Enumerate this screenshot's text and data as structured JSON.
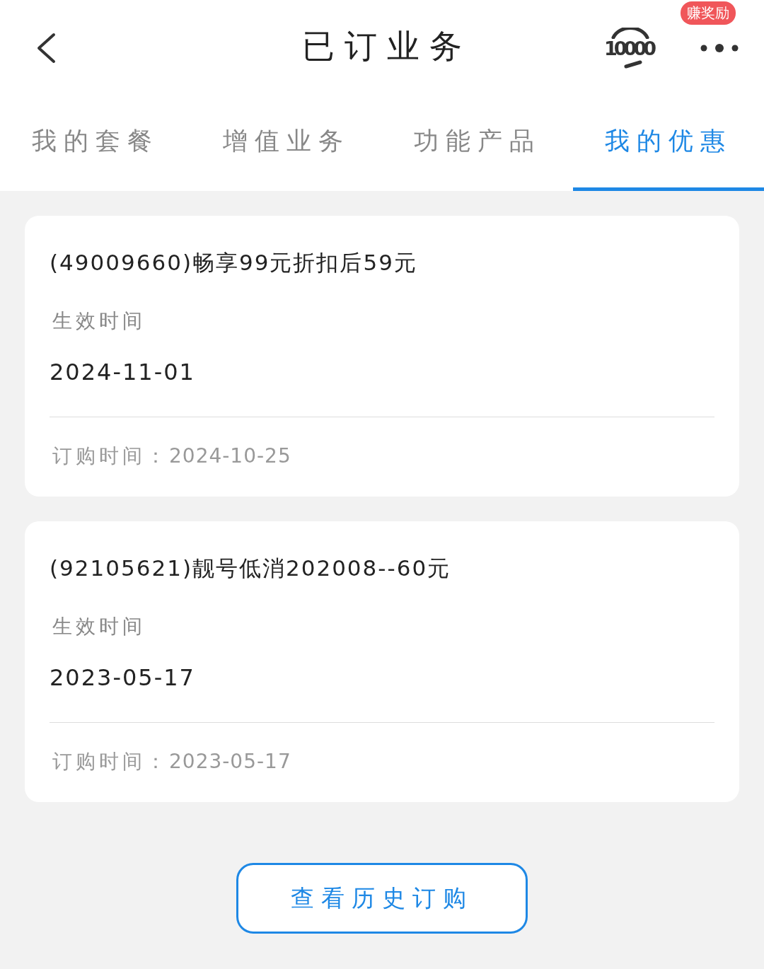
{
  "header": {
    "title": "已订业务",
    "hotline_label": "10000",
    "reward_badge": "赚奖励"
  },
  "tabs": [
    {
      "label": "我的套餐",
      "selected": false
    },
    {
      "label": "增值业务",
      "selected": false
    },
    {
      "label": "功能产品",
      "selected": false
    },
    {
      "label": "我的优惠",
      "selected": true
    }
  ],
  "offers": [
    {
      "name": "(49009660)畅享99元折扣后59元",
      "effective_label": "生效时间",
      "effective_date": "2024-11-01",
      "order_label": "订购时间：",
      "order_date": "2024-10-25"
    },
    {
      "name": "(92105621)靓号低消202008--60元",
      "effective_label": "生效时间",
      "effective_date": "2023-05-17",
      "order_label": "订购时间：",
      "order_date": "2023-05-17"
    }
  ],
  "history_button": "查看历史订购"
}
